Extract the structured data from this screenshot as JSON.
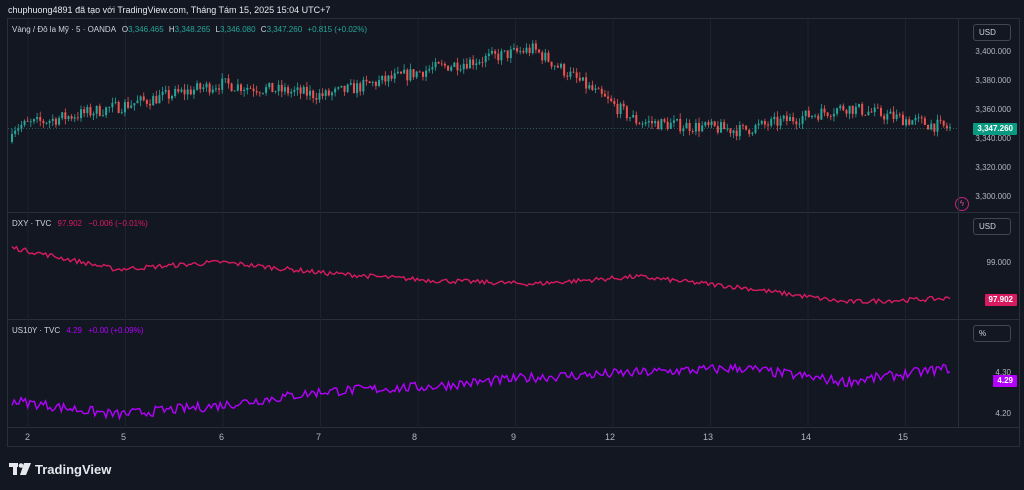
{
  "caption": "chuphuong4891 đã tạo với TradingView.com, Tháng Tám 15, 2025 15:04 UTC+7",
  "colors": {
    "background": "#131722",
    "grid": "#1e222d",
    "bull": "#26a69a",
    "bear": "#ef5350",
    "dxy": "#d81b60",
    "us10y": "#b300ff",
    "gold_tag": "#089981"
  },
  "panes": {
    "price": {
      "symbol": "Vàng / Đô la Mỹ · 5 · OANDA",
      "o_label": "O",
      "o_value": "3,346.465",
      "h_label": "H",
      "h_value": "3,348.265",
      "l_label": "L",
      "l_value": "3,346.080",
      "c_label": "C",
      "c_value": "3,347.260",
      "change": "+0.815 (+0.02%)",
      "unit": "USD",
      "last_tag": "3,347.260",
      "ticks": [
        "3,400.000",
        "3,380.000",
        "3,360.000",
        "3,340.000",
        "3,320.000",
        "3,300.000"
      ],
      "tick_values": [
        3400,
        3380,
        3360,
        3340,
        3320,
        3300
      ],
      "last_value": 3347.26
    },
    "dxy": {
      "symbol": "DXY · TVC",
      "value": "97.902",
      "change": "−0.006 (−0.01%)",
      "unit": "USD",
      "last_tag": "97.902",
      "ticks": [
        "99.000"
      ],
      "tick_values": [
        99.0
      ],
      "last_value": 97.902
    },
    "us10y": {
      "symbol": "US10Y · TVC",
      "value": "4.29",
      "change": "+0.00 (+0.09%)",
      "unit": "%",
      "last_tag": "4.29",
      "ticks": [
        "4.30",
        "4.20"
      ],
      "tick_values": [
        4.3,
        4.2
      ],
      "last_value": 4.29
    }
  },
  "time_axis": [
    "2",
    "5",
    "6",
    "7",
    "8",
    "9",
    "12",
    "13",
    "14",
    "15"
  ],
  "brand": "TradingView",
  "chart_data": [
    {
      "type": "line",
      "title": "Vàng / Đô la Mỹ · 5 · OANDA",
      "x": [
        "2",
        "5",
        "6",
        "7",
        "8",
        "9",
        "12",
        "13",
        "14",
        "15"
      ],
      "series": [
        {
          "name": "Vàng / Đô la Mỹ",
          "values": [
            3348,
            3362,
            3378,
            3370,
            3388,
            3402,
            3352,
            3346,
            3362,
            3347.26
          ]
        }
      ],
      "ylim": [
        3295,
        3410
      ]
    },
    {
      "type": "line",
      "title": "DXY · TVC",
      "x": [
        "2",
        "5",
        "6",
        "7",
        "8",
        "9",
        "12",
        "13",
        "14",
        "15"
      ],
      "series": [
        {
          "name": "DXY",
          "values": [
            99.3,
            98.7,
            98.9,
            98.6,
            98.4,
            98.3,
            98.5,
            98.2,
            97.8,
            97.902
          ]
        }
      ],
      "ylim": [
        97.5,
        99.7
      ]
    },
    {
      "type": "line",
      "title": "US10Y · TVC",
      "x": [
        "2",
        "5",
        "6",
        "7",
        "8",
        "9",
        "12",
        "13",
        "14",
        "15"
      ],
      "series": [
        {
          "name": "US10Y",
          "values": [
            4.22,
            4.19,
            4.21,
            4.24,
            4.25,
            4.27,
            4.28,
            4.29,
            4.26,
            4.29
          ]
        }
      ],
      "ylim": [
        4.17,
        4.35
      ]
    }
  ]
}
